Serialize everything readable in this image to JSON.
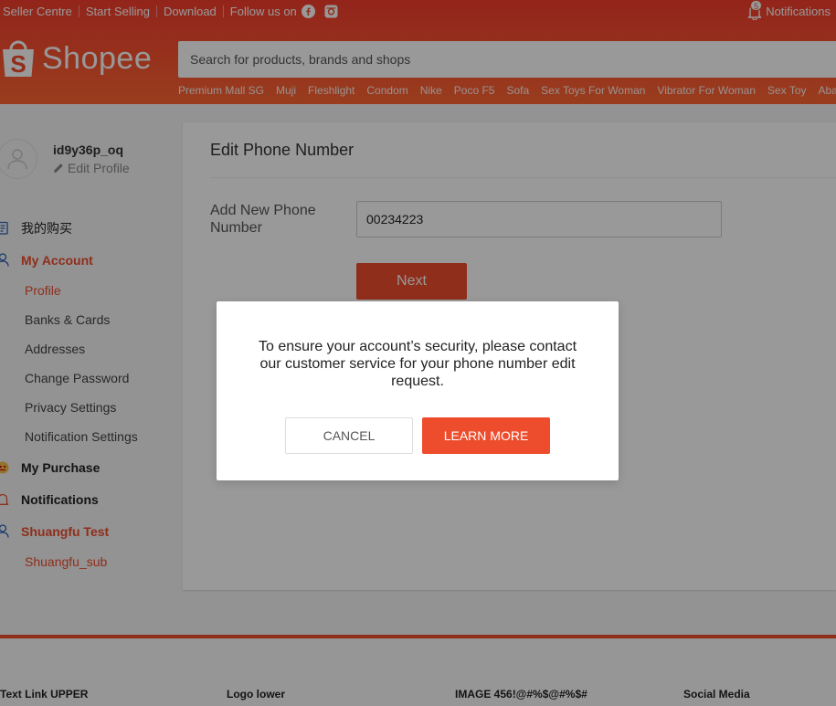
{
  "header": {
    "links": [
      "Seller Centre",
      "Start Selling",
      "Download"
    ],
    "follow_label": "Follow us on",
    "notifications_label": "Notifications",
    "notifications_count": "5",
    "logo_text": "Shopee",
    "search_placeholder": "Search for products, brands and shops",
    "hotwords": [
      "Premium Mall SG",
      "Muji",
      "Fleshlight",
      "Condom",
      "Nike",
      "Poco F5",
      "Sofa",
      "Sex Toys For Woman",
      "Vibrator For Woman",
      "Sex Toy",
      "Abaya"
    ]
  },
  "sidebar": {
    "username": "id9y36p_oq",
    "edit_profile": "Edit Profile",
    "purchase_cn": "我的购买",
    "my_account": "My Account",
    "account_items": [
      "Profile",
      "Banks & Cards",
      "Addresses",
      "Change Password",
      "Privacy Settings",
      "Notification Settings"
    ],
    "my_purchase": "My Purchase",
    "notifications": "Notifications",
    "shuangfu": "Shuangfu Test",
    "shuangfu_sub": "Shuangfu_sub"
  },
  "main": {
    "title": "Edit Phone Number",
    "field_label": "Add New Phone Number",
    "field_value": "00234223",
    "next_label": "Next"
  },
  "modal": {
    "message": "To ensure your account’s security, please contact our customer service for your phone number edit request.",
    "cancel_label": "CANCEL",
    "learn_more_label": "LEARN MORE"
  },
  "footer": {
    "columns": [
      "Text Link UPPER",
      "Logo lower",
      "IMAGE 456!@#%$@#%$#",
      "Social Media"
    ]
  },
  "colors": {
    "brand": "#ee4d2d",
    "header_gradient": [
      "#f53d2d",
      "#ff6633"
    ]
  }
}
